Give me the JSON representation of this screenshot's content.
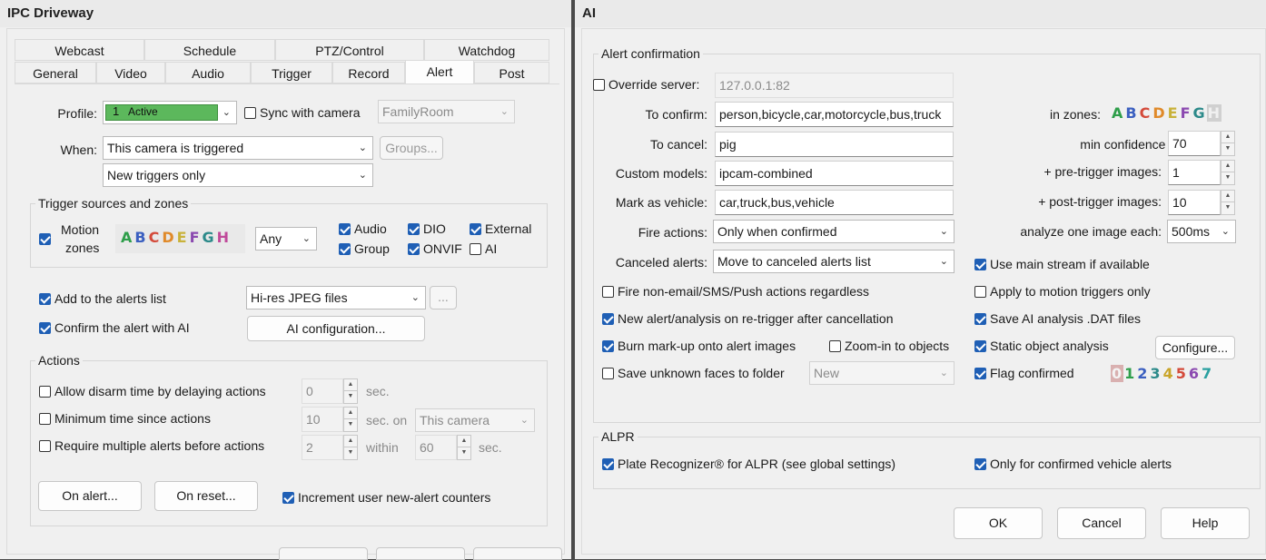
{
  "left_window": {
    "title": "IPC Driveway",
    "tabs_row1": [
      "Webcast",
      "Schedule",
      "PTZ/Control",
      "Watchdog"
    ],
    "tabs_row2": [
      "General",
      "Video",
      "Audio",
      "Trigger",
      "Record",
      "Alert",
      "Post"
    ],
    "selected_tab": "Alert",
    "profile": {
      "label": "Profile:",
      "number": "1",
      "value": "Active",
      "color": "#5cb85c"
    },
    "sync": {
      "label": "Sync with camera",
      "checked": false,
      "camera": "FamilyRoom"
    },
    "when": {
      "label": "When:",
      "value": "This camera is triggered",
      "groups_button": "Groups...",
      "sub_value": "New triggers only"
    },
    "trigger_sources": {
      "title": "Trigger sources and zones",
      "motion_label_1": "Motion",
      "motion_label_2": "zones",
      "motion_checked": true,
      "zones": [
        "A",
        "B",
        "C",
        "D",
        "E",
        "F",
        "G",
        "H"
      ],
      "zone_mode": "Any",
      "audio": "Audio",
      "dio": "DIO",
      "external": "External",
      "group": "Group",
      "onvif": "ONVIF",
      "ai": "AI"
    },
    "add_to_alerts": {
      "label": "Add to the alerts list",
      "checked": true,
      "value": "Hi-res JPEG files",
      "more": "..."
    },
    "confirm_ai": {
      "label": "Confirm the alert with AI",
      "checked": true,
      "button": "AI configuration..."
    },
    "actions": {
      "title": "Actions",
      "disarm": {
        "label": "Allow disarm time by delaying actions",
        "value": "0",
        "unit": "sec."
      },
      "min_time": {
        "label": "Minimum time since actions",
        "value": "10",
        "unit": "sec. on",
        "camera": "This camera"
      },
      "multiple": {
        "label": "Require multiple alerts before actions",
        "value": "2",
        "within": "within",
        "secs": "60",
        "unit": "sec."
      },
      "on_alert": "On alert...",
      "on_reset": "On reset...",
      "increment": "Increment user new-alert counters"
    }
  },
  "right_window": {
    "title": "AI",
    "alert_confirmation": {
      "title": "Alert confirmation",
      "override_label": "Override server:",
      "override_value": "127.0.0.1:82",
      "to_confirm_label": "To confirm:",
      "to_confirm": "person,bicycle,car,motorcycle,bus,truck",
      "to_cancel_label": "To cancel:",
      "to_cancel": "pig",
      "custom_models_label": "Custom models:",
      "custom_models": "ipcam-combined",
      "mark_vehicle_label": "Mark as vehicle:",
      "mark_vehicle": "car,truck,bus,vehicle",
      "fire_actions_label": "Fire actions:",
      "fire_actions": "Only when confirmed",
      "canceled_alerts_label": "Canceled alerts:",
      "canceled_alerts": "Move to canceled alerts list",
      "in_zones_label": "in zones:",
      "zones": [
        "A",
        "B",
        "C",
        "D",
        "E",
        "F",
        "G",
        "H"
      ],
      "min_confidence_label": "min confidence (%):",
      "min_confidence": "70",
      "pre_trigger_label": "+ pre-trigger images:",
      "pre_trigger": "1",
      "post_trigger_label": "+ post-trigger images:",
      "post_trigger": "10",
      "analyze_label": "analyze one image each:",
      "analyze": "500ms",
      "use_main_stream": "Use main stream if available",
      "fire_non_email": "Fire non-email/SMS/Push actions regardless",
      "apply_motion": "Apply to motion triggers only",
      "new_alert": "New alert/analysis on re-trigger after cancellation",
      "save_dat": "Save AI analysis .DAT files",
      "burn_markup": "Burn mark-up onto alert images",
      "zoom_in": "Zoom-in to objects",
      "static_analysis": "Static object analysis",
      "configure": "Configure...",
      "save_faces": "Save unknown faces to folder",
      "faces_folder": "New",
      "flag_confirmed": "Flag confirmed",
      "flag_digits": [
        "0",
        "1",
        "2",
        "3",
        "4",
        "5",
        "6",
        "7"
      ]
    },
    "alpr": {
      "title": "ALPR",
      "plate_recognizer": "Plate Recognizer® for ALPR (see global settings)",
      "only_confirmed": "Only for confirmed vehicle alerts"
    },
    "buttons": {
      "ok": "OK",
      "cancel": "Cancel",
      "help": "Help"
    }
  },
  "zone_colors": [
    "#2e9e4a",
    "#3b5fc0",
    "#d44a3a",
    "#e08a2a",
    "#c9b23a",
    "#8b49b0",
    "#2c8a8a",
    "#c04a9a"
  ],
  "flag_colors": [
    "#b0b0b0",
    "#2e9e4a",
    "#3b5fc0",
    "#2c8a8a",
    "#c9a52a",
    "#d44a3a",
    "#8b49b0",
    "#2aa0a0"
  ],
  "accent": "#1f5fb5"
}
